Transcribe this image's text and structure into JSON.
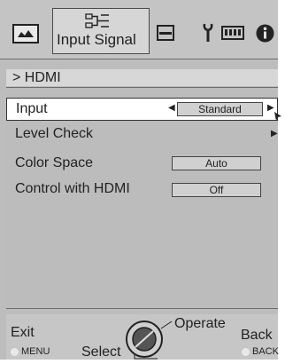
{
  "tabs": {
    "picture": {
      "icon": "picture-icon"
    },
    "input_signal": {
      "label": "Input Signal",
      "icon": "input-signal-icon"
    },
    "display": {
      "icon": "display-icon"
    },
    "setup": {
      "icon": "wrench-icon"
    },
    "memory": {
      "icon": "memory-icon"
    },
    "info": {
      "icon": "info-icon"
    }
  },
  "breadcrumb": "> HDMI",
  "menu": {
    "input": {
      "label": "Input",
      "value": "Standard"
    },
    "level_check": {
      "label": "Level Check"
    },
    "color_space": {
      "label": "Color Space",
      "value": "Auto"
    },
    "control_with_hdmi": {
      "label": "Control with HDMI",
      "value": "Off"
    }
  },
  "footer": {
    "exit": "Exit",
    "menu": "MENU",
    "select": "Select",
    "operate": "Operate",
    "back": "Back",
    "back_key": "BACK"
  },
  "colors": {
    "panel": "#bdbdbd",
    "highlight": "#ffffff",
    "value_box": "#d0d0d0"
  }
}
